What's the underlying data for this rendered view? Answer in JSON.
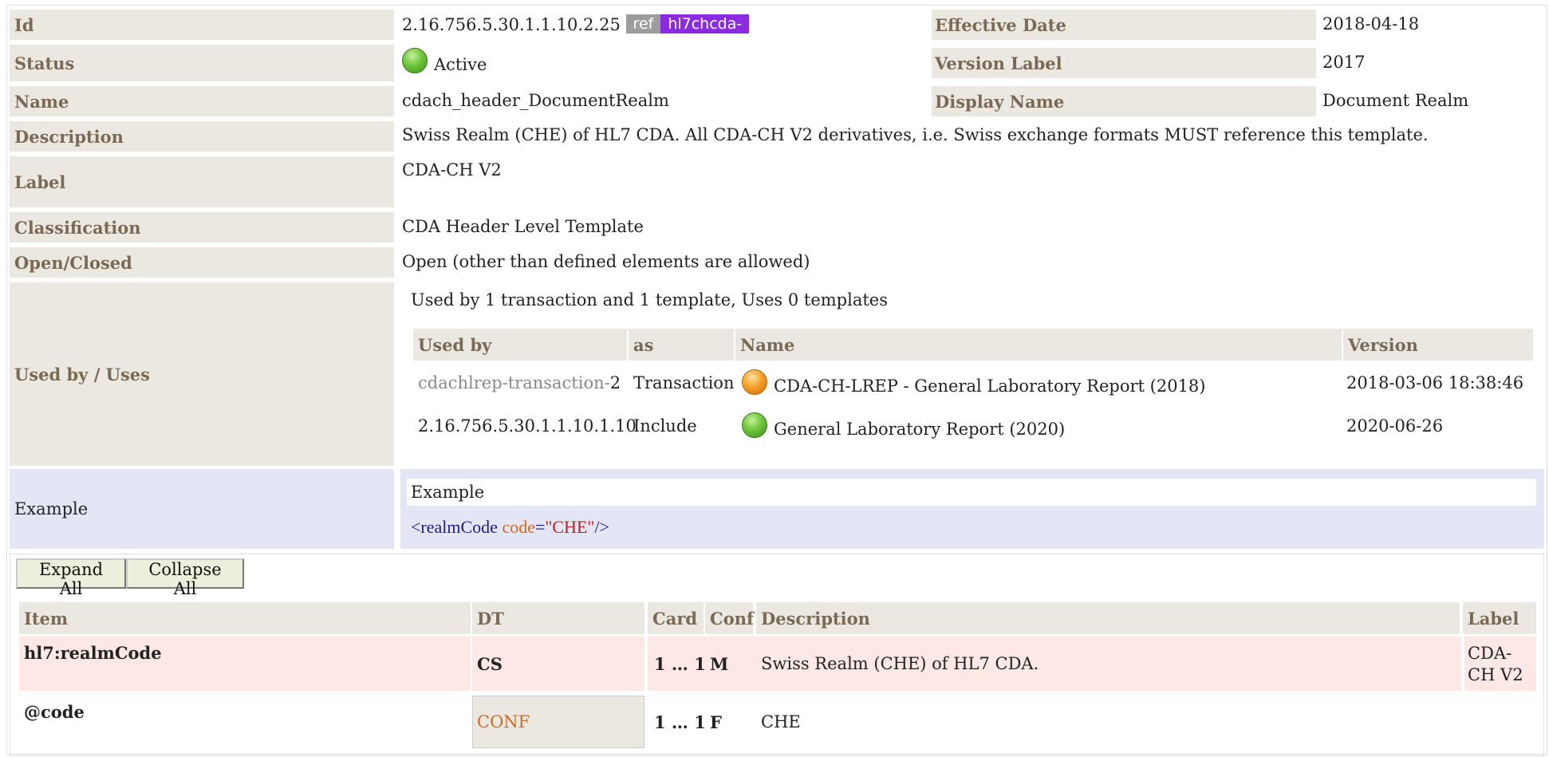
{
  "props": {
    "id_label": "Id",
    "id_value": "2.16.756.5.30.1.1.10.2.25",
    "ref_badge": "ref",
    "prefix_badge": "hl7chcda-",
    "effective_date_label": "Effective Date",
    "effective_date_value": "2018-04-18",
    "status_label": "Status",
    "status_value": "Active",
    "version_label_label": "Version Label",
    "version_label_value": "2017",
    "name_label": "Name",
    "name_value": "cdach_header_DocumentRealm",
    "display_name_label": "Display Name",
    "display_name_value": "Document Realm",
    "description_label": "Description",
    "description_value": "Swiss Realm (CHE) of HL7 CDA. All CDA-CH V2 derivatives, i.e. Swiss exchange formats MUST reference this template.",
    "label_label": "Label",
    "label_value": "CDA-CH V2",
    "classification_label": "Classification",
    "classification_value": "CDA Header Level Template",
    "open_closed_label": "Open/Closed",
    "open_closed_value": "Open (other than defined elements are allowed)",
    "used_by_label": "Used by / Uses"
  },
  "used_by": {
    "summary": "Used by 1 transaction and 1 template, Uses 0 templates",
    "headers": [
      "Used by",
      "as",
      "Name",
      "Version"
    ],
    "rows": [
      {
        "id_prefix": "cdachlrep-transaction-",
        "id_suffix": "2",
        "as": "Transaction",
        "status_color": "orange",
        "name": "CDA-CH-LREP - General Laboratory Report (2018)",
        "version": "2018-03-06 18:38:46"
      },
      {
        "id_prefix": "",
        "id_suffix": "2.16.756.5.30.1.1.10.1.10",
        "as": "Include",
        "status_color": "green",
        "name": "General Laboratory Report (2020)",
        "version": "2020-06-26"
      }
    ]
  },
  "example": {
    "label": "Example",
    "title": "Example",
    "code_lt": "<",
    "code_tag": "realmCode",
    "code_attr": "code",
    "code_eq": "=",
    "code_val": "\"CHE\"",
    "code_end": "/>"
  },
  "buttons": {
    "expand_all": "Expand All",
    "collapse_all": "Collapse All"
  },
  "items_table": {
    "headers": [
      "Item",
      "DT",
      "Card",
      "Conf",
      "Description",
      "Label"
    ],
    "rows": [
      {
        "item": "hl7:realmCode",
        "dt": "CS",
        "card": "1 … 1",
        "conf": "M",
        "description": "Swiss Realm (CHE) of HL7 CDA.",
        "label": "CDA-CH V2"
      },
      {
        "item": "@code",
        "dt": "CONF",
        "card": "1 … 1",
        "conf": "F",
        "description": "CHE",
        "label": ""
      }
    ]
  },
  "colors": {
    "header_bg": "#ebe8e2",
    "header_text": "#7a6a55",
    "example_bg": "#e4e6f6",
    "row_pink": "#fde8e6",
    "prefix_badge": "#8a2be2",
    "ref_badge": "#9c9c9c"
  }
}
